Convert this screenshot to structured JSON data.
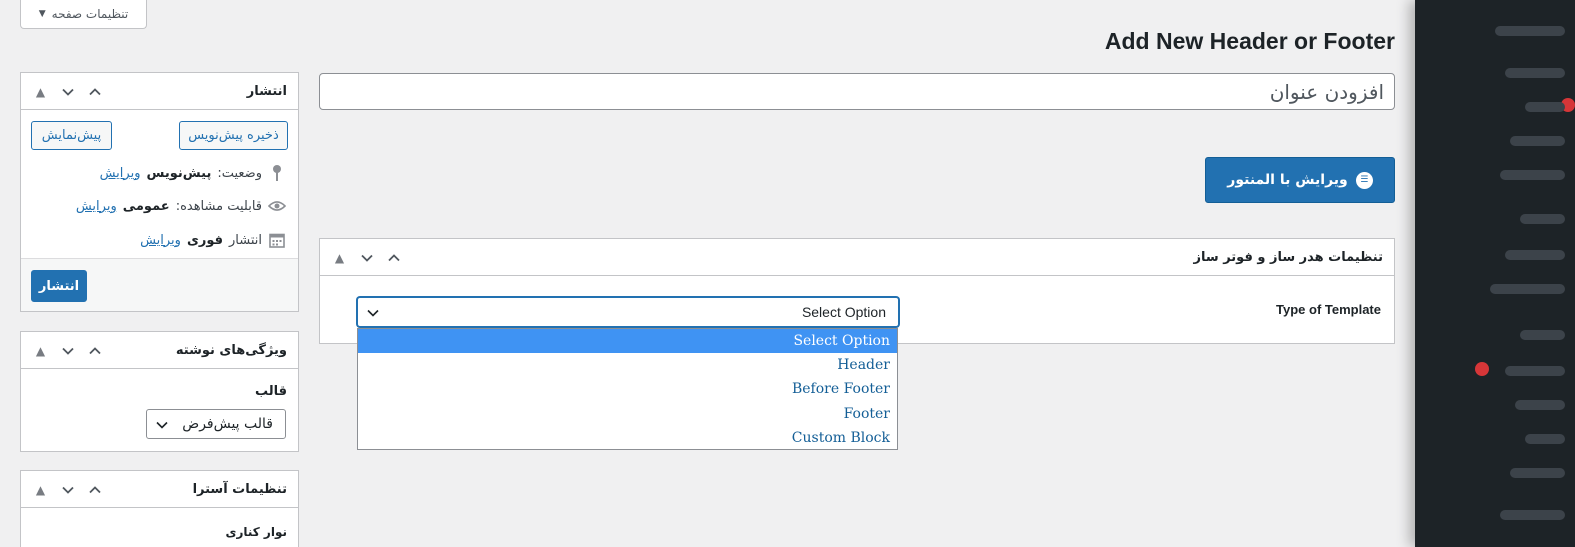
{
  "screen_options": {
    "label": "تنظیمات صفحه",
    "arrow": "▼"
  },
  "page_title": "Add New Header or Footer",
  "title_input": {
    "placeholder": "افزودن عنوان",
    "value": ""
  },
  "elementor_button": {
    "label": "ویرایش با المنتور",
    "icon": "elementor-icon"
  },
  "template_settings": {
    "title": "تنظیمات هدر ساز و فوتر ساز",
    "type_label": "Type of Template",
    "selected": "Select Option",
    "options": [
      "Select Option",
      "Header",
      "Before Footer",
      "Footer",
      "Custom Block"
    ]
  },
  "publish": {
    "title": "انتشار",
    "save_draft": "ذخیره پیش‌نویس",
    "preview": "پیش‌نمایش",
    "status_label": "وضعیت:",
    "status_value": "پیش‌نویس",
    "visibility_label": "قابلیت مشاهده:",
    "visibility_value": "عمومی",
    "schedule_label": "انتشار",
    "schedule_value": "فوری",
    "edit": "ویرایش",
    "publish_button": "انتشار"
  },
  "attributes": {
    "title": "ویژگی‌های نوشته",
    "template_label": "قالب",
    "template_value": "قالب پیش‌فرض"
  },
  "astra": {
    "title": "تنظیمات آسترا",
    "sub_label": "نوار کناری"
  },
  "colors": {
    "accent": "#2271b1",
    "highlight": "#3f93f3",
    "sidebar": "#1d2327"
  }
}
